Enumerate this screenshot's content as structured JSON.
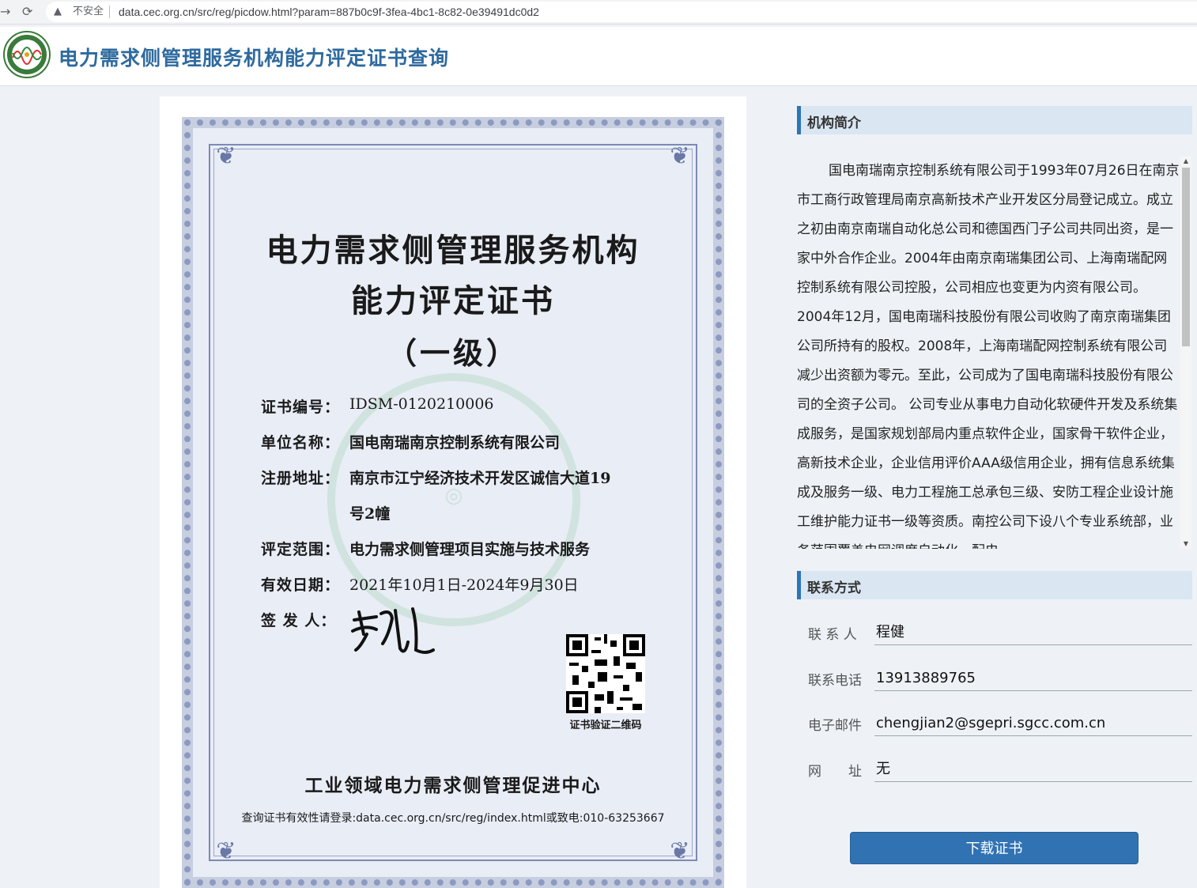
{
  "browser": {
    "security_label": "不安全",
    "url": "data.cec.org.cn/src/reg/picdow.html?param=887b0c9f-3fea-4bc1-8c82-0e39491dc0d2"
  },
  "header": {
    "title": "电力需求侧管理服务机构能力评定证书查询"
  },
  "certificate": {
    "title_line1": "电力需求侧管理服务机构",
    "title_line2": "能力评定证书",
    "level": "（一级）",
    "fields": [
      {
        "label": "证书编号：",
        "value": "IDSM-0120210006"
      },
      {
        "label": "单位名称：",
        "value": "国电南瑞南京控制系统有限公司"
      },
      {
        "label": "注册地址：",
        "value": "南京市江宁经济技术开发区诚信大道19"
      },
      {
        "label": "评定范围：",
        "value": "电力需求侧管理项目实施与技术服务"
      },
      {
        "label": "有效日期：",
        "value": "2021年10月1日-2024年9月30日"
      },
      {
        "label": "签 发 人：",
        "value": ""
      }
    ],
    "address_line2": "号2幢",
    "qr_label": "证书验证二维码",
    "issuer": "工业领域电力需求侧管理促进中心",
    "verify_note": "查询证书有效性请登录:data.cec.org.cn/src/reg/index.html或致电:010-63253667"
  },
  "intro": {
    "heading": "机构简介",
    "text": "国电南瑞南京控制系统有限公司于1993年07月26日在南京市工商行政管理局南京高新技术产业开发区分局登记成立。成立之初由南京南瑞自动化总公司和德国西门子公司共同出资，是一家中外合作企业。2004年由南京南瑞集团公司、上海南瑞配网控制系统有限公司控股，公司相应也变更为内资有限公司。2004年12月，国电南瑞科技股份有限公司收购了南京南瑞集团公司所持有的股权。2008年，上海南瑞配网控制系统有限公司减少出资额为零元。至此，公司成为了国电南瑞科技股份有限公司的全资子公司。 公司专业从事电力自动化软硬件开发及系统集成服务，是国家规划部局内重点软件企业，国家骨干软件企业，高新技术企业，企业信用评价AAA级信用企业，拥有信息系统集成及服务一级、电力工程施工总承包三级、安防工程企业设计施工维护能力证书一级等资质。南控公司下设八个专业系统部，业务范围覆盖电网调度自动化、配电"
  },
  "contact": {
    "heading": "联系方式",
    "rows": [
      {
        "label": "联 系 人",
        "value": "程健"
      },
      {
        "label": "联系电话",
        "value": "13913889765"
      },
      {
        "label": "电子邮件",
        "value": "chengjian2@sgepri.sgcc.com.cn"
      },
      {
        "label": "网　　址",
        "value": "无"
      }
    ]
  },
  "download_button": "下载证书",
  "colors": {
    "accent": "#2e75b6",
    "title_blue": "#2e6a9e",
    "button": "#3172b3"
  }
}
